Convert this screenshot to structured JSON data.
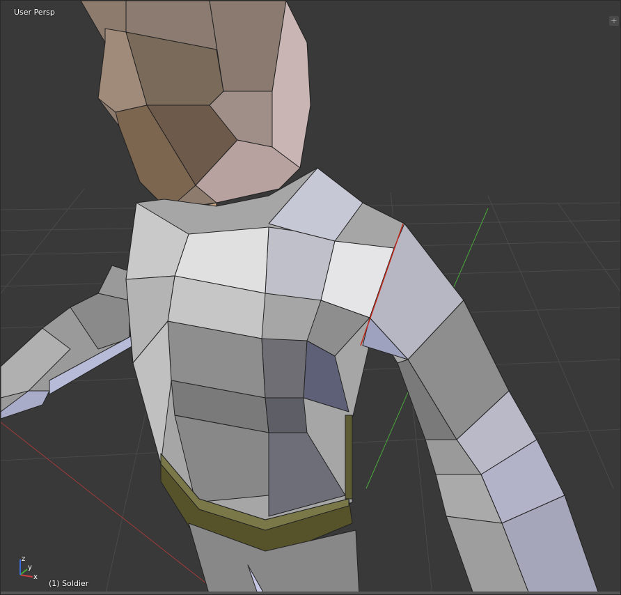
{
  "viewport": {
    "view_name": "User Persp",
    "object_label": "(1) Soldier",
    "split_widget": "+",
    "background_color": "#393939",
    "grid_color": "#4a4a4a",
    "x_axis_color": "#a03a3a",
    "y_axis_color": "#4aa83a",
    "z_axis_color": "#3a6ad8",
    "selected_edge_color": "#c0281c",
    "gizmo": {
      "x_label": "x",
      "y_label": "y",
      "z_label": "z"
    }
  }
}
